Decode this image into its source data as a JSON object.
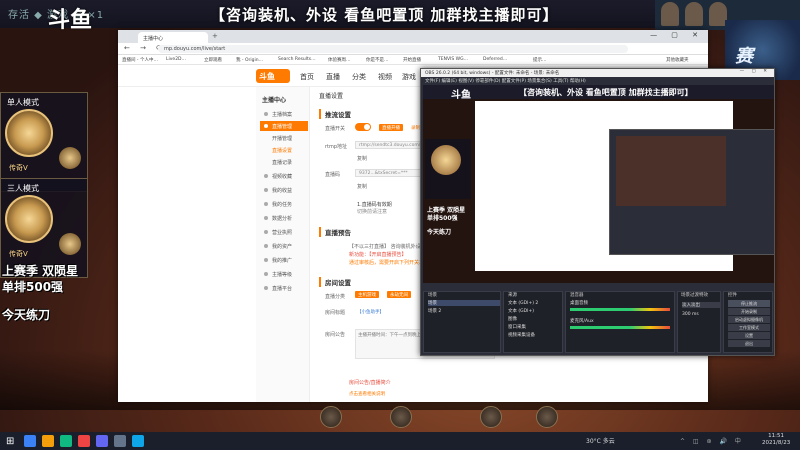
{
  "stream_overlay": {
    "logo": "斗鱼",
    "hud_left": "存活 ◆ 游戏 ♛ ×1",
    "banner": "【咨询装机、外设 看鱼吧置顶 加群找主播即可】",
    "right_logo": "赛",
    "left_cards": [
      {
        "title": "单人模式",
        "rank": "传奇V"
      },
      {
        "title": "三人模式",
        "rank": "传奇V"
      }
    ],
    "left_text_1": "上赛季 双陨星",
    "left_text_2": "单排500强",
    "left_text_3": "今天练刀"
  },
  "browser": {
    "tab_title": "主播中心",
    "new_tab": "+",
    "window_controls": "— ▢ ✕",
    "nav_icons": "← → ⟳",
    "url": "mp.douyu.com/live/start",
    "bookmarks": [
      "直播间 - 个人中…",
      "Live2D…",
      "立即观看",
      "我 - Origin…",
      "Search Results…",
      "体验赛周…",
      "你是不是…",
      "开始直播",
      "TENVIS WG…",
      "Deferred…",
      "提示…",
      "其他收藏夹"
    ],
    "site": {
      "logo_text": "斗鱼",
      "nav": [
        "首页",
        "直播",
        "分类",
        "视频",
        "游戏"
      ],
      "sidebar_header": "主播中心",
      "sidebar_items": [
        "主播档案",
        "直播管理",
        "开播管理",
        "直播设置",
        "直播记录",
        "视频收藏",
        "我的收益",
        "我的任务",
        "数据分析",
        "营业执照",
        "我的资产",
        "我的推广",
        "主播等级",
        "直播平台"
      ],
      "sidebar_active_index": 1,
      "breadcrumb": "直播设置",
      "section_push": "推流设置",
      "label_live_switch": "直播开关",
      "btn_start_live": "直播开播",
      "btn_record": "录制",
      "label_rtmp": "rtmp地址",
      "rtmp_value": "rtmp://sendtc3.douyu.com/live",
      "copy_1": "复制",
      "label_key": "直播码",
      "key_value": "9372...&txSecret=***",
      "copy_2": "复制",
      "hint_1": "1.直播码有效期",
      "hint_2": "切换前请注意",
      "section_notice": "直播预告",
      "notice_text": "【不以三打直播】 咨询装机外设",
      "notice_red": "新功能：【开启直播预告】",
      "notice_orange": "通过审核后，需要开启下列开关才能生效",
      "section_room": "房间设置",
      "label_category": "直播分类",
      "category_tag": "主机游戏",
      "category_btn": "永劫无间",
      "label_title": "房间标题",
      "title_value": "【小鱼助手】",
      "label_notice": "房间公告",
      "notice_area": "主播开播时间：下午一点到晚上…",
      "bottom_hint": "房间公告/直播简介",
      "bottom_link": "点击查看相关说明"
    }
  },
  "obs": {
    "title": "OBS 26.0.2 (64 bit, windows) - 配置文件: 未命名 - 场景: 未命名",
    "window_controls": "— ▢ ✕",
    "menu": "文件(F)  编辑(E)  视图(V)  停靠部件(D)  配置文件(P)  场景集合(S)  工具(T)  帮助(H)",
    "panels": {
      "scenes": "场景",
      "sources": "来源",
      "mixer": "混音器",
      "transitions": "场景过渡特效",
      "controls": "控件"
    },
    "scenes_list": [
      "场景",
      "场景 2"
    ],
    "sources_list": [
      "文本 (GDI+) 2",
      "文本 (GDI+)",
      "图像",
      "窗口采集",
      "视频采集设备"
    ],
    "mixer_items": [
      "桌面音频",
      "麦克风/Aux"
    ],
    "transition": "淡入淡出",
    "duration": "300 ms",
    "controls": [
      "停止推流",
      "开始录制",
      "启动虚拟摄像机",
      "工作室模式",
      "设置",
      "退出"
    ]
  },
  "taskbar": {
    "start_icon": "⊞",
    "weather": "30°C 多云",
    "tray": "^ ◫ ⊛ 🔊 中",
    "time": "11:51",
    "date": "2021/8/23"
  }
}
